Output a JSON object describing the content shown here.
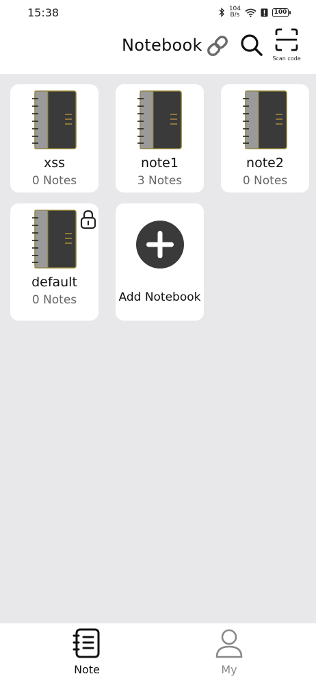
{
  "status_bar": {
    "time": "15:38",
    "net_speed_value": "104",
    "net_speed_unit": "B/s",
    "battery": "100"
  },
  "header": {
    "title": "Notebook",
    "scan_label": "Scan code",
    "icons": [
      "link-icon",
      "search-icon",
      "scan-code-icon"
    ]
  },
  "notebooks": [
    {
      "name": "xss",
      "count": "0 Notes",
      "locked": false
    },
    {
      "name": "note1",
      "count": "3 Notes",
      "locked": false
    },
    {
      "name": "note2",
      "count": "0 Notes",
      "locked": false
    },
    {
      "name": "default",
      "count": "0 Notes",
      "locked": true
    }
  ],
  "add_notebook": {
    "label": "Add Notebook"
  },
  "bottom_nav": {
    "items": [
      {
        "label": "Note",
        "icon": "note-icon",
        "active": true
      },
      {
        "label": "My",
        "icon": "person-icon",
        "active": false
      }
    ]
  },
  "colors": {
    "background": "#e8e7ea",
    "card": "#ffffff",
    "notebook_cover": "#3a3a3a",
    "notebook_spine": "#9a9a9a",
    "notebook_border": "#8a7a2a",
    "active_nav": "#111111",
    "inactive_nav": "#888888"
  }
}
